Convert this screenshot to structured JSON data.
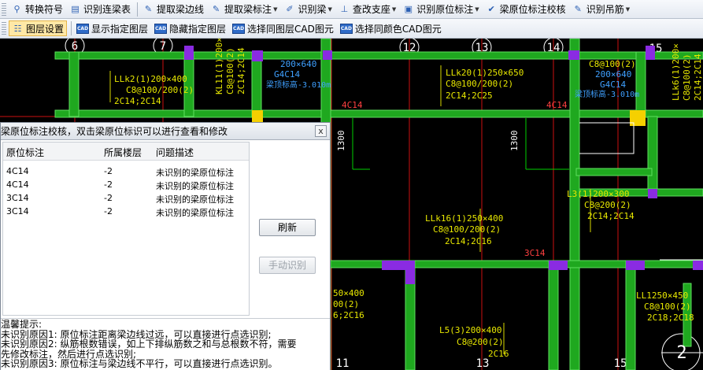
{
  "toolbar1": {
    "items": [
      {
        "label": "转换符号",
        "icon": "convert-symbol-icon"
      },
      {
        "label": "识别连梁表",
        "icon": "table-icon"
      },
      {
        "label": "提取梁边线",
        "icon": "extract-icon"
      },
      {
        "label": "提取梁标注",
        "icon": "extract-icon",
        "dropdown": true
      },
      {
        "label": "识别梁",
        "icon": "beam-icon",
        "dropdown": true
      },
      {
        "label": "查改支座",
        "icon": "support-icon",
        "dropdown": true
      },
      {
        "label": "识别原位标注",
        "icon": "mark-icon",
        "dropdown": true
      },
      {
        "label": "梁原位标注校核",
        "icon": "check-icon"
      },
      {
        "label": "识别吊筋",
        "icon": "hanger-icon",
        "dropdown": true
      }
    ]
  },
  "toolbar2": {
    "items": [
      {
        "label": "图层设置",
        "icon": "layer-icon",
        "active": true
      },
      {
        "label": "显示指定图层",
        "icon": "cad-icon"
      },
      {
        "label": "隐藏指定图层",
        "icon": "cad-icon"
      },
      {
        "label": "选择同图层CAD图元",
        "icon": "cad-icon"
      },
      {
        "label": "选择同颜色CAD图元",
        "icon": "cad-icon"
      }
    ]
  },
  "canvas": {
    "axis_labels": [
      "6",
      "7",
      "12",
      "13",
      "14",
      "15",
      "11",
      "13",
      "15"
    ],
    "annotations": {
      "a1": "LLk2(1)200×400",
      "a2": "C8@100/200(2)",
      "a3": "2C14;2C14",
      "a4": "KL11(1)200×",
      "a5": "C8@100(2)",
      "a6": "2C14;2C14",
      "a7": "200×640",
      "a8": "G4C14",
      "a9": "梁顶标高-3.010m",
      "a10": "LLk20(1)250×650",
      "a11": "C8@100/200(2)",
      "a12": "2C14;2C25",
      "a13": "C8@100(2)",
      "a14": "200×640",
      "a15": "G4C14",
      "a16": "梁顶标高-3.010m",
      "a17": "LLk6(1)200×",
      "a18": "C8@100(2)",
      "a19": "2C14;2C14",
      "a20": "4C14",
      "a21": "4C14",
      "a22": "1300",
      "a23": "1300",
      "a24": "L3(1)200×300",
      "a25": "C8@200(2)",
      "a26": "2C14;2C14",
      "a27": "LLk16(1)250×400",
      "a28": "C8@100/200(2)",
      "a29": "2C14;2C16",
      "a30": "3C14",
      "a31": "LL1250×450",
      "a32": "C8@100(2)",
      "a33": "2C18;2C18",
      "a34": "50×400",
      "a35": "00(2)",
      "a36": "6;2C16",
      "a37": "L5(3)200×400",
      "a38": "C8@200(2)",
      "a39": "2C16",
      "a40": "2"
    }
  },
  "panel": {
    "title": "梁原位标注校核，双击梁原位标识可以进行查看和修改",
    "close_label": "x",
    "columns": [
      "原位标注",
      "所属楼层",
      "问题描述"
    ],
    "rows": [
      {
        "mark": "4C14",
        "floor": "-2",
        "issue": "未识别的梁原位标注"
      },
      {
        "mark": "4C14",
        "floor": "-2",
        "issue": "未识别的梁原位标注"
      },
      {
        "mark": "3C14",
        "floor": "-2",
        "issue": "未识别的梁原位标注"
      },
      {
        "mark": "3C14",
        "floor": "-2",
        "issue": "未识别的梁原位标注"
      }
    ],
    "refresh_label": "刷新",
    "manual_label": "手动识别",
    "hints": [
      "温馨提示:",
      "未识别原因1: 原位标注距离梁边线过远，可以直接进行点选识别;",
      "未识别原因2: 纵筋根数错误，如上下排纵筋数之和与总根数不符，需要",
      "先修改标注，然后进行点选识别;",
      "未识别原因3: 原位标注与梁边线不平行，可以直接进行点选识别。"
    ]
  }
}
